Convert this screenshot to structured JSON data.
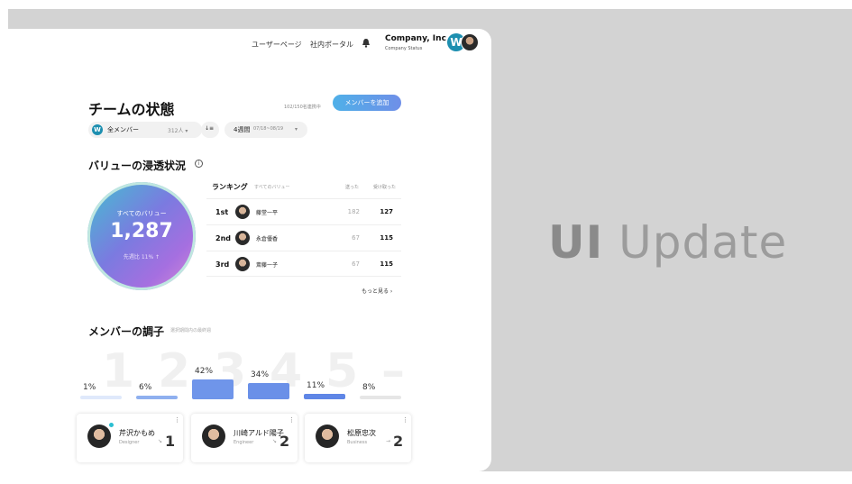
{
  "header": {
    "links": [
      "ユーザーページ",
      "社内ポータル"
    ],
    "company_name": "Company, Inc",
    "company_status": "Company Status",
    "workspace_initial": "W"
  },
  "page": {
    "title": "チームの状態",
    "capacity": "102/150名連携中",
    "add_button": "メンバーを追加"
  },
  "filters": {
    "member_initial": "W",
    "member_label": "全メンバー",
    "member_count": "312人 ▾",
    "sort_icon": "↓≡",
    "period_label": "4週間",
    "period_range": "07/18~08/19",
    "period_caret": "▾"
  },
  "value_section": {
    "title": "バリューの浸透状況",
    "info": "i",
    "circle_label": "すべてのバリュー",
    "circle_value": "1,287",
    "circle_compare": "先週比 11% ↑"
  },
  "ranking": {
    "title": "ランキング",
    "subtitle": "すべてのバリュー",
    "col_sent": "送った",
    "col_received": "受け取った",
    "rows": [
      {
        "pos": "1st",
        "name": "藤堂一平",
        "sent": "182",
        "received": "127"
      },
      {
        "pos": "2nd",
        "name": "永倉優香",
        "sent": "67",
        "received": "115"
      },
      {
        "pos": "3rd",
        "name": "斎藤一子",
        "sent": "67",
        "received": "115"
      }
    ],
    "more": "もっと見る ›"
  },
  "condition": {
    "title": "メンバーの調子",
    "note": "選択期間内の最終週",
    "levels": [
      "1",
      "2",
      "3",
      "4",
      "5",
      "–"
    ],
    "bars": [
      {
        "label": "1%",
        "value": 1,
        "color": "#dfe9fb"
      },
      {
        "label": "6%",
        "value": 6,
        "color": "#8fb0ef"
      },
      {
        "label": "42%",
        "value": 42,
        "color": "#6f95ea"
      },
      {
        "label": "34%",
        "value": 34,
        "color": "#6a90e8"
      },
      {
        "label": "11%",
        "value": 11,
        "color": "#5f86e6"
      },
      {
        "label": "8%",
        "value": 8,
        "color": "#e6e6e6"
      }
    ]
  },
  "members": [
    {
      "name": "芹沢かもめ",
      "role": "Designer",
      "score": "1"
    },
    {
      "name": "川崎アルド陽子",
      "role": "Engineer",
      "score": "2"
    },
    {
      "name": "松原忠次",
      "role": "Business",
      "score": "2"
    }
  ],
  "brand": {
    "bold": "UI",
    "rest": "Update"
  }
}
